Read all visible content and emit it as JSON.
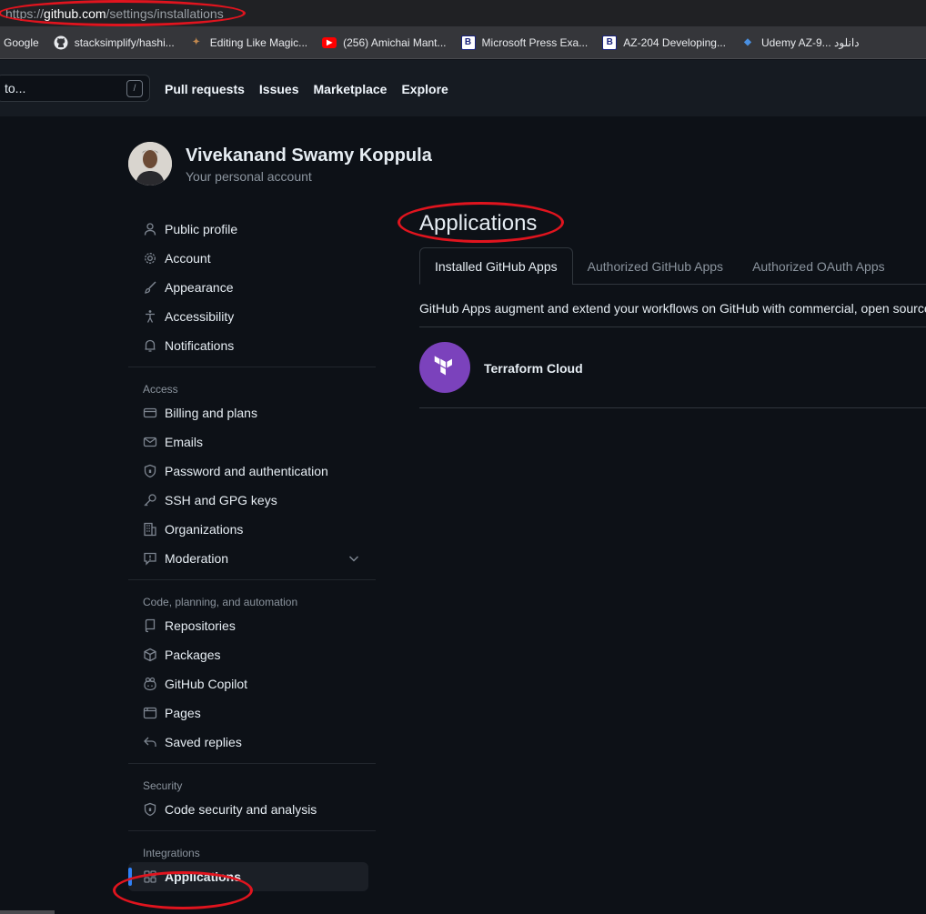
{
  "browser": {
    "url_scheme": "https://",
    "url_host": "github.com",
    "url_path": "/settings/installations",
    "bookmarks": [
      {
        "label": "Google",
        "icon": "google-icon"
      },
      {
        "label": "stacksimplify/hashi...",
        "icon": "github-icon"
      },
      {
        "label": "Editing Like Magic...",
        "icon": "figure-icon"
      },
      {
        "label": "(256) Amichai Mant...",
        "icon": "youtube-icon"
      },
      {
        "label": "Microsoft Press Exa...",
        "icon": "b-icon"
      },
      {
        "label": "AZ-204 Developing...",
        "icon": "b-icon"
      },
      {
        "label": "Udemy AZ-9... دانلود",
        "icon": "udemy-icon"
      }
    ]
  },
  "header": {
    "search_text": "to...",
    "search_shortcut": "/",
    "nav": [
      "Pull requests",
      "Issues",
      "Marketplace",
      "Explore"
    ]
  },
  "profile": {
    "name": "Vivekanand Swamy Koppula",
    "subtitle": "Your personal account"
  },
  "sidebar": {
    "group1": [
      {
        "label": "Public profile",
        "icon": "person-icon"
      },
      {
        "label": "Account",
        "icon": "gear-icon"
      },
      {
        "label": "Appearance",
        "icon": "paintbrush-icon"
      },
      {
        "label": "Accessibility",
        "icon": "accessibility-icon"
      },
      {
        "label": "Notifications",
        "icon": "bell-icon"
      }
    ],
    "access_heading": "Access",
    "access": [
      {
        "label": "Billing and plans",
        "icon": "credit-card-icon"
      },
      {
        "label": "Emails",
        "icon": "mail-icon"
      },
      {
        "label": "Password and authentication",
        "icon": "shield-lock-icon"
      },
      {
        "label": "SSH and GPG keys",
        "icon": "key-icon"
      },
      {
        "label": "Organizations",
        "icon": "organization-icon"
      },
      {
        "label": "Moderation",
        "icon": "report-icon"
      }
    ],
    "code_heading": "Code, planning, and automation",
    "code": [
      {
        "label": "Repositories",
        "icon": "repo-icon"
      },
      {
        "label": "Packages",
        "icon": "package-icon"
      },
      {
        "label": "GitHub Copilot",
        "icon": "copilot-icon"
      },
      {
        "label": "Pages",
        "icon": "browser-icon"
      },
      {
        "label": "Saved replies",
        "icon": "reply-icon"
      }
    ],
    "security_heading": "Security",
    "security": [
      {
        "label": "Code security and analysis",
        "icon": "shield-lock-icon"
      }
    ],
    "integrations_heading": "Integrations",
    "integrations": [
      {
        "label": "Applications",
        "icon": "apps-icon"
      }
    ]
  },
  "main": {
    "title": "Applications",
    "tabs": [
      "Installed GitHub Apps",
      "Authorized GitHub Apps",
      "Authorized OAuth Apps"
    ],
    "description": "GitHub Apps augment and extend your workflows on GitHub with commercial, open source",
    "apps": [
      {
        "name": "Terraform Cloud",
        "icon": "terraform-icon",
        "color": "#7b42bc"
      }
    ]
  },
  "colors": {
    "accent": "#2f81f7",
    "annotation": "#e0141e"
  }
}
